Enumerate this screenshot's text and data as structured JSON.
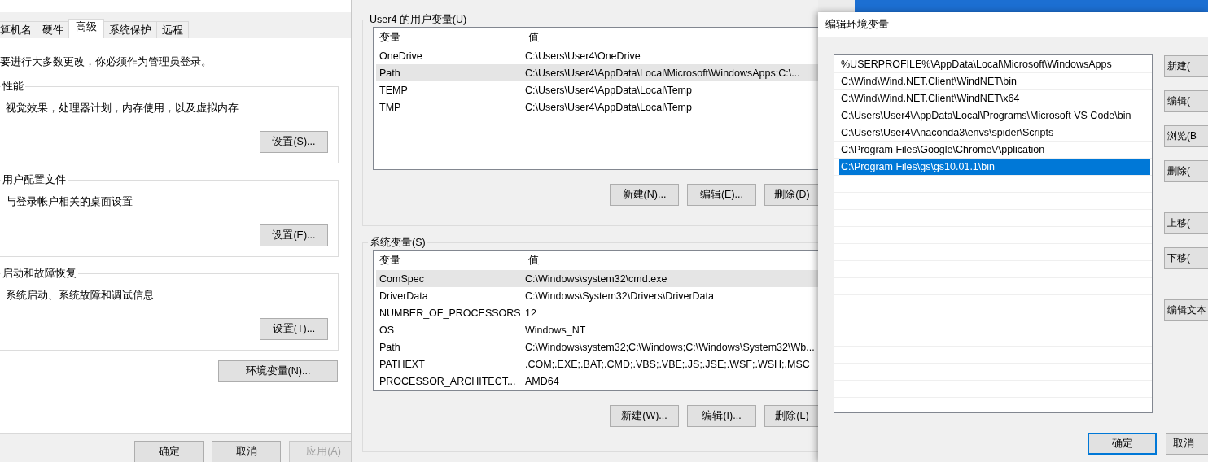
{
  "system_properties": {
    "tabs": [
      {
        "label": "算机名",
        "selected": false
      },
      {
        "label": "硬件",
        "selected": false
      },
      {
        "label": "高级",
        "selected": true
      },
      {
        "label": "系统保护",
        "selected": false
      },
      {
        "label": "远程",
        "selected": false
      }
    ],
    "admin_note": "要进行大多数更改，你必须作为管理员登录。",
    "groups": [
      {
        "title": "性能",
        "description": "视觉效果，处理器计划，内存使用，以及虚拟内存",
        "button": "设置(S)..."
      },
      {
        "title": "用户配置文件",
        "description": "与登录帐户相关的桌面设置",
        "button": "设置(E)..."
      },
      {
        "title": "启动和故障恢复",
        "description": "系统启动、系统故障和调试信息",
        "button": "设置(T)..."
      }
    ],
    "env_button": "环境变量(N)...",
    "footer_buttons": [
      {
        "label": "确定",
        "disabled": false
      },
      {
        "label": "取消",
        "disabled": false
      },
      {
        "label": "应用(A)",
        "disabled": true
      }
    ]
  },
  "environment_variables": {
    "sections": [
      {
        "title": "User4 的用户变量(U)",
        "columns": [
          "变量",
          "值"
        ],
        "rows": [
          {
            "name": "OneDrive",
            "value": "C:\\Users\\User4\\OneDrive",
            "selected": false
          },
          {
            "name": "Path",
            "value": "C:\\Users\\User4\\AppData\\Local\\Microsoft\\WindowsApps;C:\\...",
            "selected": true
          },
          {
            "name": "TEMP",
            "value": "C:\\Users\\User4\\AppData\\Local\\Temp",
            "selected": false
          },
          {
            "name": "TMP",
            "value": "C:\\Users\\User4\\AppData\\Local\\Temp",
            "selected": false
          }
        ],
        "buttons": [
          "新建(N)...",
          "编辑(E)...",
          "删除(D)"
        ]
      },
      {
        "title": "系统变量(S)",
        "columns": [
          "变量",
          "值"
        ],
        "rows": [
          {
            "name": "ComSpec",
            "value": "C:\\Windows\\system32\\cmd.exe",
            "selected": true
          },
          {
            "name": "DriverData",
            "value": "C:\\Windows\\System32\\Drivers\\DriverData",
            "selected": false
          },
          {
            "name": "NUMBER_OF_PROCESSORS",
            "value": "12",
            "selected": false
          },
          {
            "name": "OS",
            "value": "Windows_NT",
            "selected": false
          },
          {
            "name": "Path",
            "value": "C:\\Windows\\system32;C:\\Windows;C:\\Windows\\System32\\Wb...",
            "selected": false
          },
          {
            "name": "PATHEXT",
            "value": ".COM;.EXE;.BAT;.CMD;.VBS;.VBE;.JS;.JSE;.WSF;.WSH;.MSC",
            "selected": false
          },
          {
            "name": "PROCESSOR_ARCHITECT...",
            "value": "AMD64",
            "selected": false
          }
        ],
        "buttons": [
          "新建(W)...",
          "编辑(I)...",
          "删除(L)"
        ]
      }
    ]
  },
  "edit_environment_variable": {
    "title": "编辑环境变量",
    "entries": [
      {
        "text": "%USERPROFILE%\\AppData\\Local\\Microsoft\\WindowsApps",
        "selected": false
      },
      {
        "text": "C:\\Wind\\Wind.NET.Client\\WindNET\\bin",
        "selected": false
      },
      {
        "text": "C:\\Wind\\Wind.NET.Client\\WindNET\\x64",
        "selected": false
      },
      {
        "text": "C:\\Users\\User4\\AppData\\Local\\Programs\\Microsoft VS Code\\bin",
        "selected": false
      },
      {
        "text": "C:\\Users\\User4\\Anaconda3\\envs\\spider\\Scripts",
        "selected": false
      },
      {
        "text": "C:\\Program Files\\Google\\Chrome\\Application",
        "selected": false
      },
      {
        "text": "C:\\Program Files\\gs\\gs10.01.1\\bin",
        "selected": true
      }
    ],
    "side_buttons": [
      {
        "label": "新建(",
        "kind": "button"
      },
      {
        "label": "编辑(",
        "kind": "button"
      },
      {
        "label": "浏览(B",
        "kind": "button"
      },
      {
        "label": "删除(",
        "kind": "button"
      },
      {
        "kind": "gap"
      },
      {
        "label": "上移(",
        "kind": "button"
      },
      {
        "label": "下移(",
        "kind": "button"
      },
      {
        "kind": "gap"
      },
      {
        "label": "编辑文本",
        "kind": "button"
      }
    ],
    "footer_buttons": [
      {
        "label": "确定",
        "focused": true
      },
      {
        "label": "取消",
        "focused": false
      }
    ]
  }
}
